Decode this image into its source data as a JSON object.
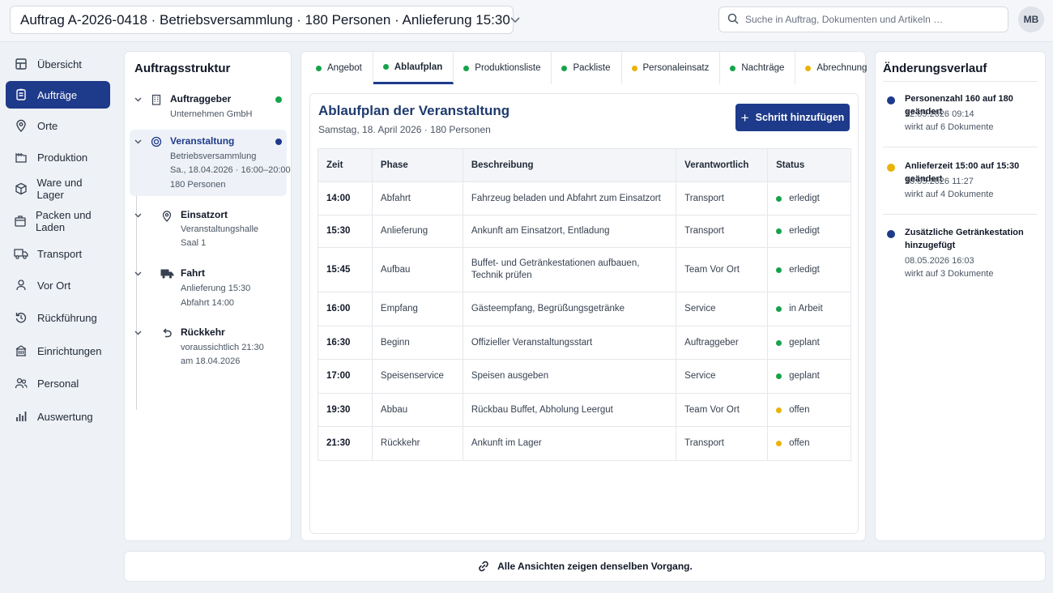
{
  "header": {
    "order_title": "Auftrag A-2026-0418 · Betriebsversammlung · 180 Personen · Anlieferung 15:30",
    "search_placeholder": "Suche in Auftrag, Dokumenten und Artikeln …",
    "user_initials": "MB"
  },
  "sidebar": {
    "items": [
      {
        "label": "Übersicht",
        "icon": "overview-icon"
      },
      {
        "label": "Aufträge",
        "icon": "orders-icon",
        "active": true
      },
      {
        "label": "Orte",
        "icon": "location-pin-icon"
      },
      {
        "label": "Produktion",
        "icon": "factory-icon"
      },
      {
        "label": "Ware und Lager",
        "icon": "box-icon"
      },
      {
        "label": "Packen und Laden",
        "icon": "package-icon"
      },
      {
        "label": "Transport",
        "icon": "truck-icon"
      },
      {
        "label": "Vor Ort",
        "icon": "person-location-icon"
      },
      {
        "label": "Rückführung",
        "icon": "return-icon"
      },
      {
        "label": "Einrichtungen",
        "icon": "building-icon"
      },
      {
        "label": "Personal",
        "icon": "people-icon"
      },
      {
        "label": "Auswertung",
        "icon": "bar-chart-icon"
      }
    ]
  },
  "structure": {
    "title": "Auftragsstruktur",
    "nodes": [
      {
        "title": "Auftraggeber",
        "lines": [
          "Unternehmen GmbH"
        ],
        "status_color": "#16a34a"
      },
      {
        "title": "Veranstaltung",
        "lines": [
          "Betriebsversammlung",
          "Sa., 18.04.2026 · 16:00–20:00",
          "180 Personen"
        ],
        "status_color": "#1e3a8a"
      },
      {
        "title": "Einsatzort",
        "lines": [
          "Veranstaltungshalle",
          "Saal 1"
        ]
      },
      {
        "title": "Fahrt",
        "lines": [
          "Anlieferung 15:30",
          "Abfahrt 14:00"
        ]
      },
      {
        "title": "Rückkehr",
        "lines": [
          "voraussichtlich 21:30",
          "am 18.04.2026"
        ]
      }
    ]
  },
  "tabs": [
    {
      "label": "Angebot",
      "color": "#16a34a"
    },
    {
      "label": "Ablaufplan",
      "color": "#16a34a",
      "active": true
    },
    {
      "label": "Produktionsliste",
      "color": "#16a34a"
    },
    {
      "label": "Packliste",
      "color": "#16a34a"
    },
    {
      "label": "Personaleinsatz",
      "color": "#eab308"
    },
    {
      "label": "Nachträge",
      "color": "#16a34a"
    },
    {
      "label": "Abrechnung",
      "color": "#eab308"
    }
  ],
  "plan": {
    "title": "Ablaufplan der Veranstaltung",
    "date": "Samstag, 18. April 2026 · 180 Personen",
    "add_button": "Schritt hinzufügen",
    "columns": [
      "Zeit",
      "Phase",
      "Beschreibung",
      "Verantwortlich",
      "Status"
    ],
    "rows": [
      {
        "zeit": "14:00",
        "phase": "Abfahrt",
        "beschreibung": "Fahrzeug beladen und Abfahrt zum Einsatzort",
        "verantwortlich": "Transport",
        "status": "erledigt",
        "status_color": "#16a34a"
      },
      {
        "zeit": "15:30",
        "phase": "Anlieferung",
        "beschreibung": "Ankunft am Einsatzort, Entladung",
        "verantwortlich": "Transport",
        "status": "erledigt",
        "status_color": "#16a34a"
      },
      {
        "zeit": "15:45",
        "phase": "Aufbau",
        "beschreibung": "Buffet- und Getränkestationen aufbauen, Technik prüfen",
        "verantwortlich": "Team Vor Ort",
        "status": "erledigt",
        "status_color": "#16a34a"
      },
      {
        "zeit": "16:00",
        "phase": "Empfang",
        "beschreibung": "Gästeempfang, Begrüßungsgetränke",
        "verantwortlich": "Service",
        "status": "in Arbeit",
        "status_color": "#16a34a"
      },
      {
        "zeit": "16:30",
        "phase": "Beginn",
        "beschreibung": "Offizieller Veranstaltungsstart",
        "verantwortlich": "Auftraggeber",
        "status": "geplant",
        "status_color": "#16a34a"
      },
      {
        "zeit": "17:00",
        "phase": "Speisenservice",
        "beschreibung": "Speisen ausgeben",
        "verantwortlich": "Service",
        "status": "geplant",
        "status_color": "#16a34a"
      },
      {
        "zeit": "19:30",
        "phase": "Abbau",
        "beschreibung": "Rückbau Buffet, Abholung Leergut",
        "verantwortlich": "Team Vor Ort",
        "status": "offen",
        "status_color": "#eab308"
      },
      {
        "zeit": "21:30",
        "phase": "Rückkehr",
        "beschreibung": "Ankunft im Lager",
        "verantwortlich": "Transport",
        "status": "offen",
        "status_color": "#eab308"
      }
    ]
  },
  "history": {
    "title": "Änderungsverlauf",
    "entries": [
      {
        "title": "Personenzahl 160 auf 180 geändert",
        "timestamp": "12.05.2026 09:14",
        "effect": "wirkt auf 6 Dokumente",
        "color": "#1e3a8a"
      },
      {
        "title": "Anlieferzeit 15:00 auf 15:30 geändert",
        "timestamp": "10.05.2026 11:27",
        "effect": "wirkt auf 4 Dokumente",
        "color": "#eab308"
      },
      {
        "title": "Zusätzliche Getränkestation hinzugefügt",
        "timestamp": "08.05.2026 16:03",
        "effect": "wirkt auf 3 Dokumente",
        "color": "#1e3a8a"
      }
    ]
  },
  "footer": {
    "text": "Alle Ansichten zeigen denselben Vorgang.",
    "icon": "link-icon"
  }
}
